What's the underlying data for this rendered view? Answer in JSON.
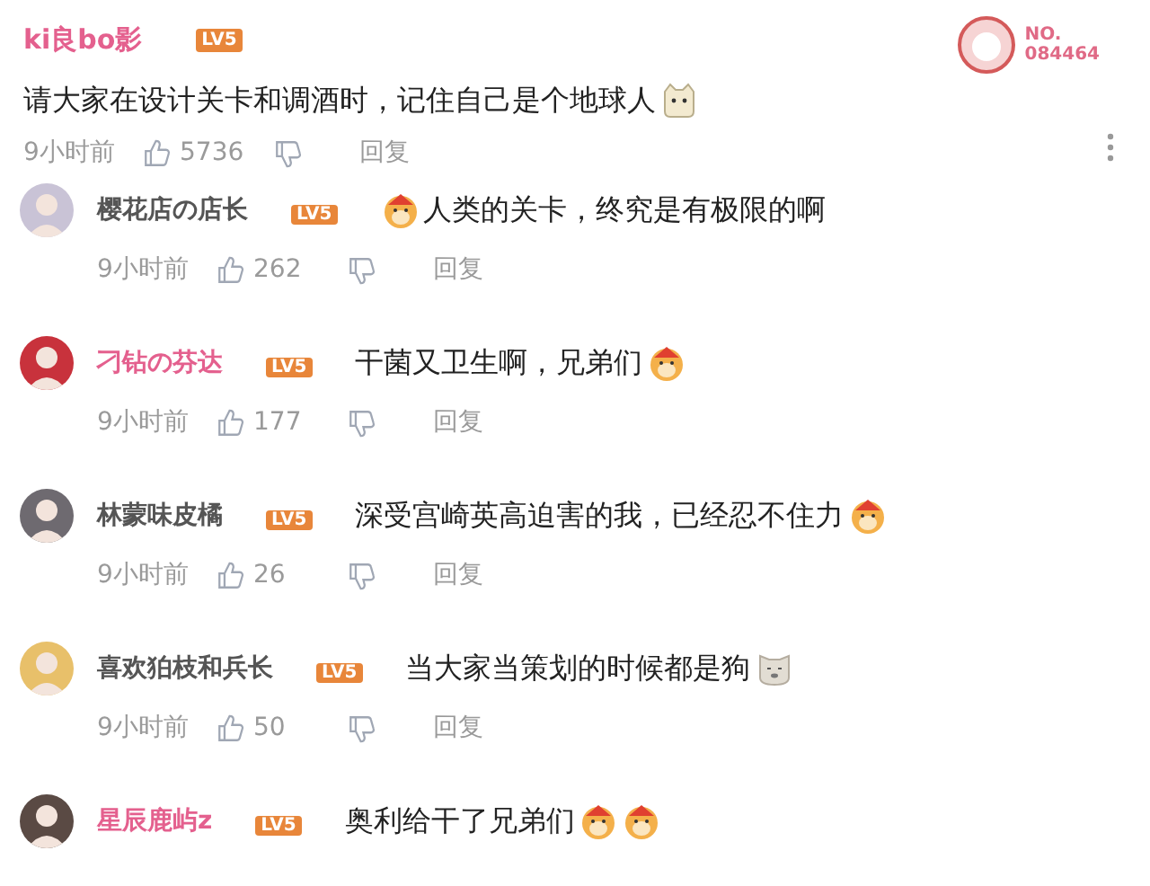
{
  "top_comment": {
    "user": {
      "name": "ki良bo影",
      "color": "#e4608e",
      "level": "LV5"
    },
    "badge": {
      "label": "NO.",
      "number": "084464"
    },
    "content": [
      {
        "kind": "text",
        "text": "请大家在设计关卡和调酒时，记住自己是个地球人"
      },
      {
        "kind": "cat"
      }
    ],
    "time": "9小时前",
    "likes": "5736",
    "reply": "回复"
  },
  "replies": [
    {
      "user": {
        "name": "樱花店の店长",
        "color": "#555555",
        "level": "LV5"
      },
      "avatar": {
        "color": "#c9c3d6"
      },
      "content": [
        {
          "kind": "shiba"
        },
        {
          "kind": "text",
          "text": "人类的关卡，终究是有极限的啊"
        }
      ],
      "time": "9小时前",
      "likes": "262",
      "reply": "回复"
    },
    {
      "user": {
        "name": "刁钻の芬达",
        "color": "#e4608e",
        "level": "LV5"
      },
      "avatar": {
        "color": "#c8323c"
      },
      "content": [
        {
          "kind": "text",
          "text": "干菌又卫生啊，兄弟们"
        },
        {
          "kind": "shiba"
        }
      ],
      "time": "9小时前",
      "likes": "177",
      "reply": "回复"
    },
    {
      "user": {
        "name": "林蒙味皮橘",
        "color": "#555555",
        "level": "LV5"
      },
      "avatar": {
        "color": "#6e6a70"
      },
      "content": [
        {
          "kind": "text",
          "text": "深受宫崎英高迫害的我，已经忍不住力"
        },
        {
          "kind": "shiba"
        }
      ],
      "time": "9小时前",
      "likes": "26",
      "reply": "回复"
    },
    {
      "user": {
        "name": "喜欢狛枝和兵长",
        "color": "#555555",
        "level": "LV5"
      },
      "avatar": {
        "color": "#e8c06a"
      },
      "content": [
        {
          "kind": "text",
          "text": "当大家当策划的时候都是狗"
        },
        {
          "kind": "dog"
        }
      ],
      "time": "9小时前",
      "likes": "50",
      "reply": "回复"
    },
    {
      "user": {
        "name": "星辰鹿屿z",
        "color": "#e4608e",
        "level": "LV5"
      },
      "avatar": {
        "color": "#5a4a44"
      },
      "content": [
        {
          "kind": "text",
          "text": "奥利给干了兄弟们"
        },
        {
          "kind": "shiba"
        },
        {
          "kind": "shiba"
        }
      ]
    }
  ]
}
